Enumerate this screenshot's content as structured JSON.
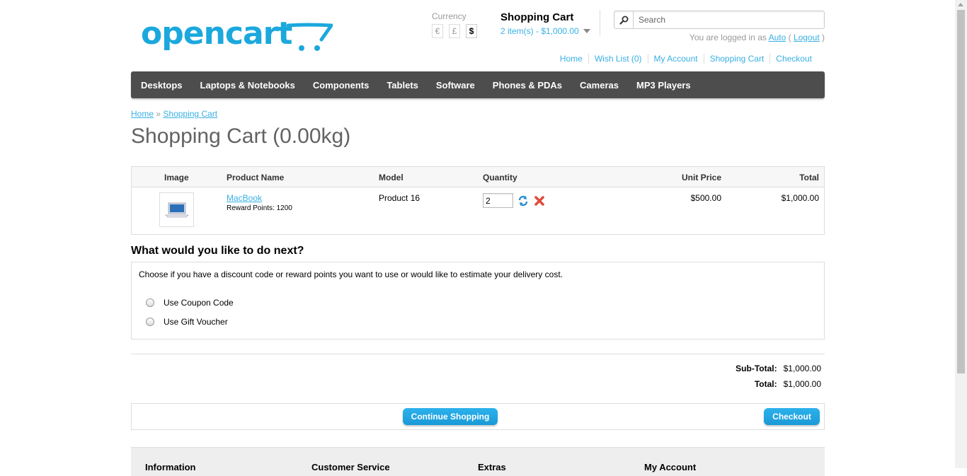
{
  "header": {
    "logo_text": "opencart",
    "currency_label": "Currency",
    "currencies": [
      "€",
      "£",
      "$"
    ],
    "cart_title": "Shopping Cart",
    "cart_total": "2 item(s) - $1,000.00",
    "search_placeholder": "Search",
    "welcome_prefix": "You are logged in as",
    "welcome_user": "Auto",
    "welcome_open": "(",
    "welcome_logout": "Logout",
    "welcome_close": ")",
    "links": [
      "Home",
      "Wish List (0)",
      "My Account",
      "Shopping Cart",
      "Checkout"
    ]
  },
  "menu": [
    "Desktops",
    "Laptops & Notebooks",
    "Components",
    "Tablets",
    "Software",
    "Phones & PDAs",
    "Cameras",
    "MP3 Players"
  ],
  "breadcrumb": {
    "home": "Home",
    "sep": "»",
    "current": "Shopping Cart"
  },
  "page_title": "Shopping Cart  (0.00kg)",
  "cart": {
    "headers": {
      "image": "Image",
      "name": "Product Name",
      "model": "Model",
      "quantity": "Quantity",
      "unit_price": "Unit Price",
      "total": "Total"
    },
    "item": {
      "name": "MacBook",
      "reward": "Reward Points: 1200",
      "model": "Product 16",
      "quantity": "2",
      "unit_price": "$500.00",
      "total": "$1,000.00"
    }
  },
  "next": {
    "title": "What would you like to do next?",
    "text": "Choose if you have a discount code or reward points you want to use or would like to estimate your delivery cost.",
    "options": [
      "Use Coupon Code",
      "Use Gift Voucher"
    ]
  },
  "totals": {
    "subtotal_label": "Sub-Total:",
    "subtotal_value": "$1,000.00",
    "total_label": "Total:",
    "total_value": "$1,000.00"
  },
  "buttons": {
    "continue": "Continue Shopping",
    "checkout": "Checkout"
  },
  "footer": [
    "Information",
    "Customer Service",
    "Extras",
    "My Account"
  ],
  "colors": {
    "accent": "#38B0E3",
    "menu_bg": "#4d4d4d",
    "button": "#1BA8DD"
  }
}
